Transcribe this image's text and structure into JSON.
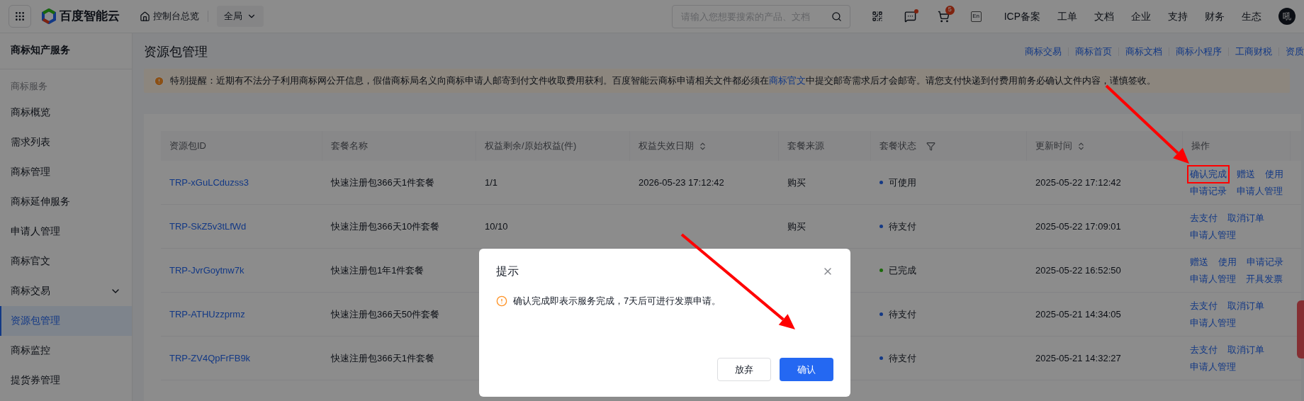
{
  "topbar": {
    "logo_text": "百度智能云",
    "home_label": "控制台总览",
    "scope": "全局",
    "search_placeholder": "请输入您想要搜索的产品、文档",
    "cart_badge": "5",
    "lang": "En",
    "message_unread": true,
    "nav": [
      "ICP备案",
      "工单",
      "文档",
      "企业",
      "支持",
      "财务",
      "生态"
    ],
    "avatar": "吼"
  },
  "sidebar": {
    "title": "商标知产服务",
    "section": "商标服务",
    "items": [
      {
        "label": "商标概览",
        "selected": false
      },
      {
        "label": "需求列表",
        "selected": false
      },
      {
        "label": "商标管理",
        "selected": false
      },
      {
        "label": "商标延伸服务",
        "selected": false
      },
      {
        "label": "申请人管理",
        "selected": false
      },
      {
        "label": "商标官文",
        "selected": false
      },
      {
        "label": "商标交易",
        "selected": false,
        "expandable": true
      },
      {
        "label": "资源包管理",
        "selected": true
      },
      {
        "label": "商标监控",
        "selected": false
      },
      {
        "label": "提货券管理",
        "selected": false
      }
    ]
  },
  "page": {
    "title": "资源包管理",
    "links": [
      "商标交易",
      "商标首页",
      "商标文档",
      "商标小程序",
      "工商财税",
      "资质"
    ],
    "notice": {
      "before": "特别提醒：近期有不法分子利用商标网公开信息，假借商标局名义向商标申请人邮寄到付文件收取费用获利。百度智能云商标申请相关文件都必须在",
      "link": "商标官文",
      "after": "中提交邮寄需求后才会邮寄。请您支付快递到付费用前务必确认文件内容，谨慎签收。"
    }
  },
  "table": {
    "columns": [
      {
        "label": "资源包ID"
      },
      {
        "label": "套餐名称"
      },
      {
        "label": "权益剩余/原始权益(件)"
      },
      {
        "label": "权益失效日期",
        "sortable": true
      },
      {
        "label": "套餐来源"
      },
      {
        "label": "套餐状态",
        "filterable": true
      },
      {
        "label": "更新时间",
        "sortable": true
      },
      {
        "label": "操作"
      }
    ],
    "rows": [
      {
        "id": "TRP-xGuLCduzss3",
        "name": "快速注册包366天1件套餐",
        "quota": "1/1",
        "expiry": "2026-05-23 17:12:42",
        "source": "购买",
        "status": "可使用",
        "color": "#143985",
        "updated": "2025-05-22 17:12:42",
        "actions": [
          [
            {
              "label": "确认完成",
              "boxed": true
            },
            {
              "label": "赠送"
            },
            {
              "label": "使用"
            }
          ],
          [
            {
              "label": "申请记录"
            },
            {
              "label": "申请人管理"
            }
          ]
        ]
      },
      {
        "id": "TRP-SkZ5v3tLfWd",
        "name": "快速注册包366天10件套餐",
        "quota": "10/10",
        "source": "购买",
        "status": "待支付",
        "color": "#143985",
        "updated": "2025-05-22 17:09:01",
        "actions": [
          [
            {
              "label": "去支付"
            },
            {
              "label": "取消订单"
            }
          ],
          [
            {
              "label": "申请人管理"
            }
          ]
        ]
      },
      {
        "id": "TRP-JvrGoytnw7k",
        "name": "快速注册包1年1件套餐",
        "status": "已完成",
        "color": "#1a690a",
        "updated": "2025-05-22 16:52:50",
        "actions": [
          [
            {
              "label": "赠送"
            },
            {
              "label": "使用"
            },
            {
              "label": "申请记录"
            }
          ],
          [
            {
              "label": "申请人管理"
            },
            {
              "label": "开具发票"
            }
          ]
        ]
      },
      {
        "id": "TRP-ATHUzzprmz",
        "name": "快速注册包366天50件套餐",
        "status": "待支付",
        "color": "#143985",
        "updated": "2025-05-21 14:34:05",
        "actions": [
          [
            {
              "label": "去支付"
            },
            {
              "label": "取消订单"
            }
          ],
          [
            {
              "label": "申请人管理"
            }
          ]
        ]
      },
      {
        "id": "TRP-ZV4QpFrFB9k",
        "name": "快速注册包366天1件套餐",
        "status": "待支付",
        "color": "#143985",
        "updated": "2025-05-21 14:32:27",
        "actions": [
          [
            {
              "label": "去支付"
            },
            {
              "label": "取消订单"
            }
          ],
          [
            {
              "label": "申请人管理"
            }
          ]
        ]
      }
    ]
  },
  "dialog": {
    "title": "提示",
    "message": "确认完成即表示服务完成，7天后可进行发票申请。",
    "buttons": [
      {
        "label": "放弃",
        "kind": "secondary"
      },
      {
        "label": "确认",
        "kind": "primary"
      }
    ]
  }
}
